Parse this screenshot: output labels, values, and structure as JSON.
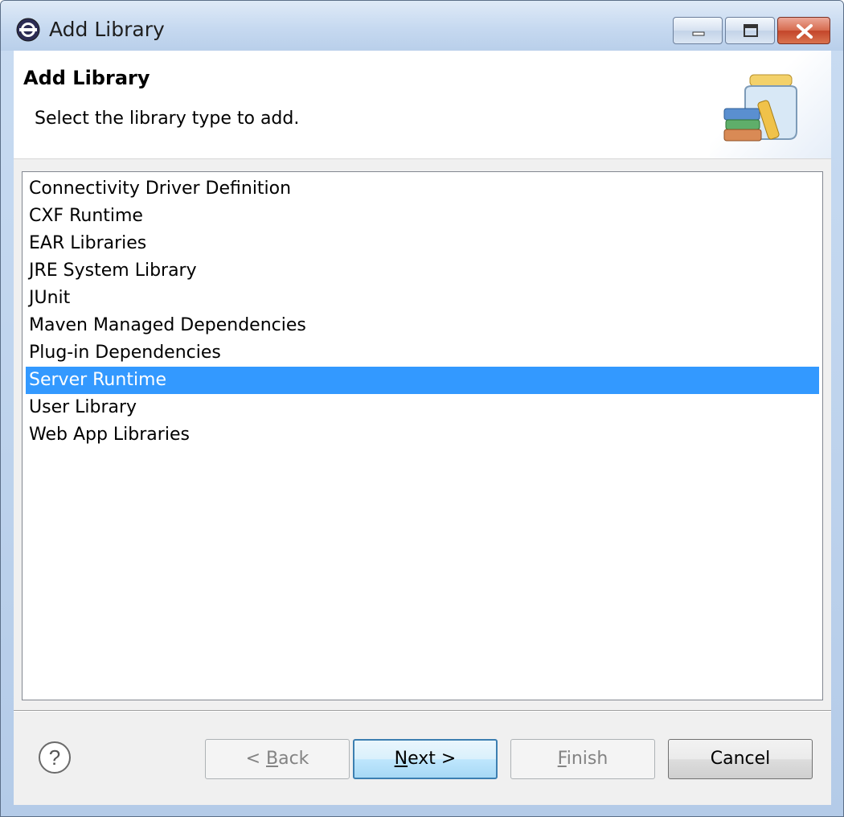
{
  "window": {
    "title": "Add Library"
  },
  "header": {
    "title": "Add Library",
    "description": "Select the library type to add."
  },
  "library_types": [
    "Connectivity Driver Definition",
    "CXF Runtime",
    "EAR Libraries",
    "JRE System Library",
    "JUnit",
    "Maven Managed Dependencies",
    "Plug-in Dependencies",
    "Server Runtime",
    "User Library",
    "Web App Libraries"
  ],
  "selected_library": "Server Runtime",
  "buttons": {
    "back": {
      "prefix": "< ",
      "mnemonic": "B",
      "rest": "ack"
    },
    "next": {
      "mnemonic": "N",
      "rest": "ext >"
    },
    "finish": {
      "mnemonic": "F",
      "rest": "inish"
    },
    "cancel": "Cancel"
  },
  "icons": {
    "app": "eclipse-icon",
    "header": "library-jar-icon",
    "help": "help-icon"
  },
  "colors": {
    "selection": "#3399ff",
    "titlebar": "#c6d9f0",
    "close_button": "#c3452a"
  }
}
